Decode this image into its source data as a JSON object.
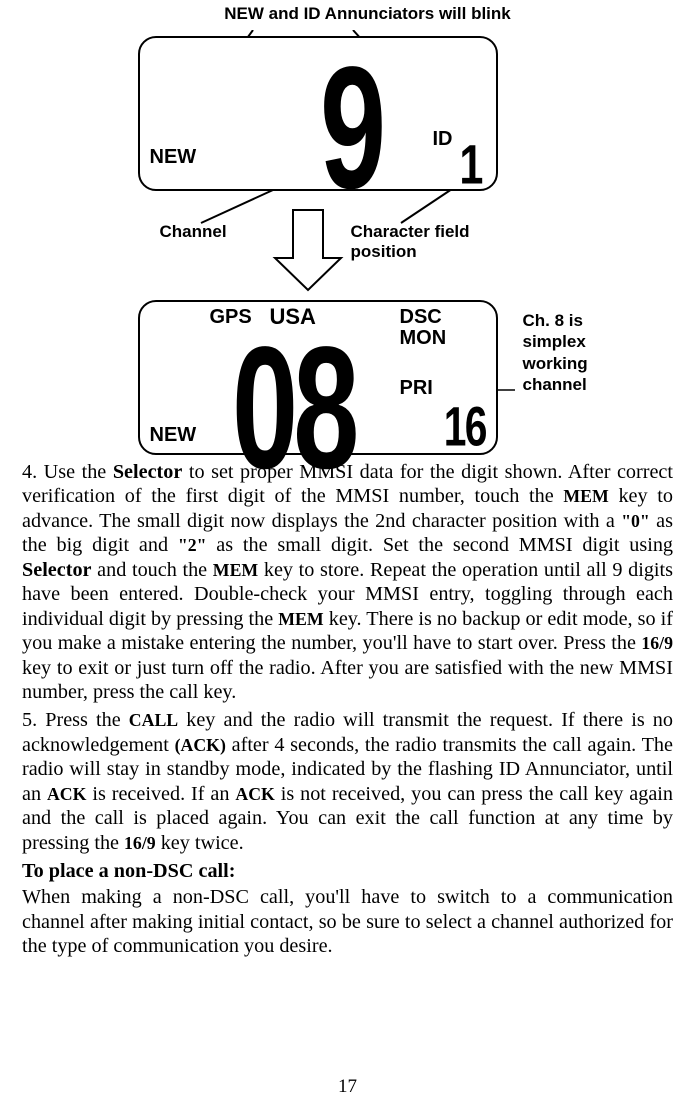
{
  "top_caption": "NEW and ID Annunciators will blink",
  "labels": {
    "channel": "Channel",
    "char_field_line1": "Character field",
    "char_field_line2": "position",
    "side_l1": "Ch. 8 is",
    "side_l2": "simplex",
    "side_l3": "working",
    "side_l4": "channel"
  },
  "lcd1": {
    "new": "NEW",
    "id": "ID",
    "big": "9",
    "small": "1"
  },
  "lcd2": {
    "gps": "GPS",
    "usa": "USA",
    "dsc": "DSC",
    "mon": "MON",
    "pri": "PRI",
    "new": "NEW",
    "big": "08",
    "small": "16"
  },
  "step4": {
    "n": "4. Use the ",
    "selector": "Selector",
    "a": " to set proper MMSI data for the digit shown. After correct verification of the first digit of the MMSI number, touch the ",
    "mem": "MEM",
    "b": " key to advance. The small digit now displays the 2nd character position with a ",
    "q0": "\"0\"",
    "c": " as the big digit and ",
    "q2": "\"2\"",
    "d": " as the small digit. Set the second MMSI digit using ",
    "selector2": "Selector",
    "e": " and touch the ",
    "mem2": "MEM",
    "f": " key to store. Repeat the operation until all 9 digits have been entered. Double-check your MMSI entry, toggling through each individual digit by pressing the ",
    "mem3": "MEM",
    "g": " key. There is no backup or edit mode, so if you make a mistake entering the number, you'll have to start over. Press the ",
    "k169": "16/9",
    "h": " key to exit or just turn off the radio. After you are satisfied with the new MMSI number, press the call key."
  },
  "step5": {
    "n": "5. Press the ",
    "call": "CALL",
    "a": " key and the radio will transmit the request. If there is no acknowledgement ",
    "ack_p": "(ACK)",
    "b": " after 4 seconds, the radio transmits the call again. The radio will stay in standby mode, indicated by the flashing ID Annunciator, until an ",
    "ack": "ACK",
    "c": " is received. If an ",
    "ack2": "ACK",
    "d": " is not received, you can press the call key again and the call is placed again. You can exit the call function at any time by pressing the ",
    "k169": "16/9",
    "e": " key twice."
  },
  "subhead": "To place a non-DSC call:",
  "para3": "When making a non-DSC call, you'll have to switch to a communication channel after making initial contact, so be sure to select a channel authorized for the type of communication you desire.",
  "page": "17"
}
